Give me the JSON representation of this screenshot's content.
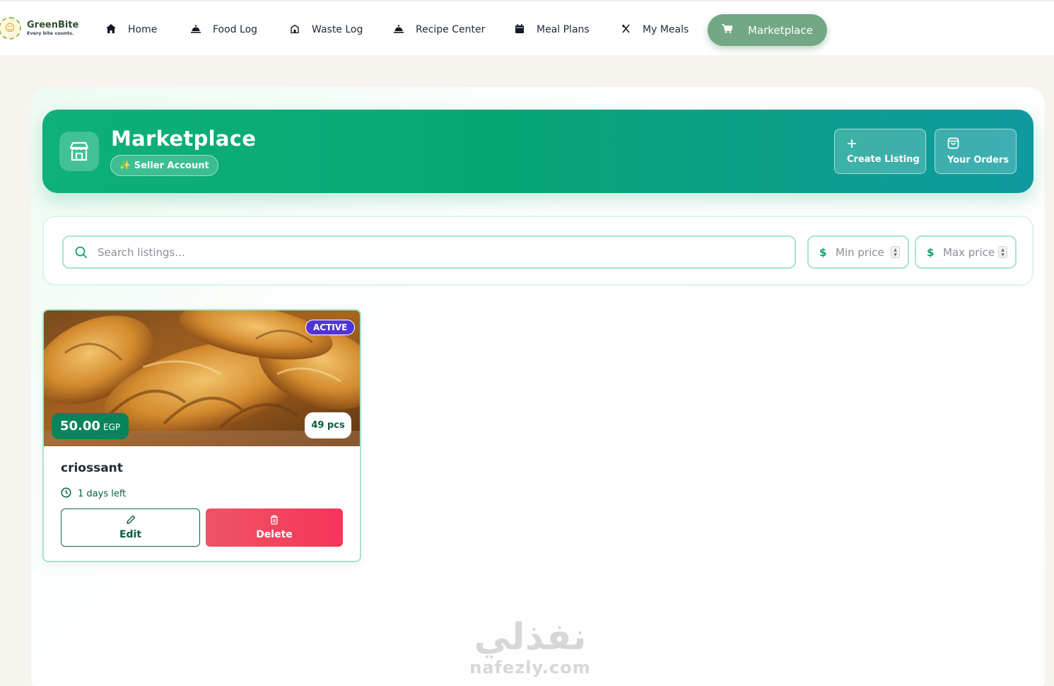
{
  "brand": {
    "name": "GreenBite",
    "tagline": "Every bite counts."
  },
  "nav": {
    "items": [
      {
        "label": "Home",
        "icon": "home-icon"
      },
      {
        "label": "Food Log",
        "icon": "cloche-icon"
      },
      {
        "label": "Waste Log",
        "icon": "bin-icon"
      },
      {
        "label": "Recipe Center",
        "icon": "cloche-icon"
      },
      {
        "label": "Meal Plans",
        "icon": "calendar-icon"
      },
      {
        "label": "My Meals",
        "icon": "utensils-icon"
      }
    ],
    "active": {
      "label": "Marketplace",
      "icon": "cart-icon"
    }
  },
  "hero": {
    "title": "Marketplace",
    "badge": "✨ Seller Account",
    "create_label": "Create Listing",
    "orders_label": "Your Orders"
  },
  "filters": {
    "search_placeholder": "Search listings...",
    "min_placeholder": "Min price",
    "max_placeholder": "Max price",
    "currency_symbol": "$"
  },
  "listing": {
    "status": "ACTIVE",
    "price": "50.00",
    "currency": "EGP",
    "quantity": "49 pcs",
    "title": "criossant",
    "days_left": "1 days left",
    "edit_label": "Edit",
    "delete_label": "Delete"
  },
  "watermark": {
    "arabic": "نفذلي",
    "latin": "nafezly.com"
  },
  "colors": {
    "accent": "#0fb07a",
    "nav_active": "#72a883",
    "status_badge": "#4f35d9",
    "price_badge": "#08845c",
    "delete": "#f7355b"
  }
}
